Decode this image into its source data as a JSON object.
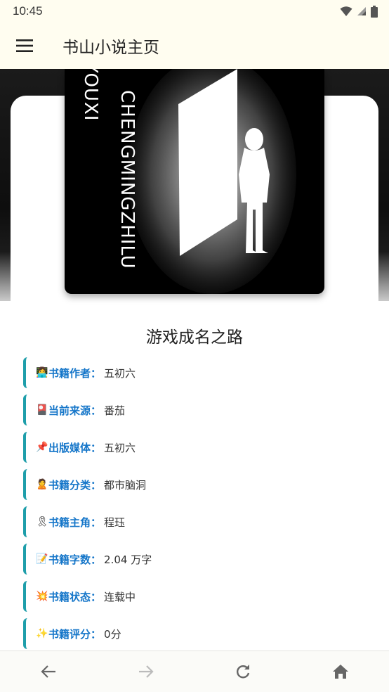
{
  "status": {
    "time": "10:45"
  },
  "app": {
    "title": "书山小说主页"
  },
  "cover": {
    "lines": [
      "YOUXI",
      "CHENGMINGZHILU"
    ]
  },
  "book": {
    "title": "游戏成名之路",
    "info": [
      {
        "emoji": "👩‍💻",
        "label": "书籍作者",
        "value": "五初六"
      },
      {
        "emoji": "🎴",
        "label": "当前来源",
        "value": "番茄"
      },
      {
        "emoji": "📌",
        "label": "出版媒体",
        "value": "五初六"
      },
      {
        "emoji": "🙎",
        "label": "书籍分类",
        "value": "都市脑洞"
      },
      {
        "emoji": "🎗",
        "label": "书籍主角",
        "value": "程珏"
      },
      {
        "emoji": "📝",
        "label": "书籍字数",
        "value": "2.04 万字"
      },
      {
        "emoji": "💥",
        "label": "书籍状态",
        "value": "连载中"
      },
      {
        "emoji": "✨",
        "label": "书籍评分",
        "value": "0分"
      }
    ],
    "colon": "："
  },
  "nav": {
    "icons": [
      "back-arrow-icon",
      "forward-arrow-icon",
      "refresh-icon",
      "home-icon"
    ]
  },
  "colors": {
    "appbar_bg": "#fffdf0",
    "accent_border": "#1e9eaa",
    "label_blue": "#1576c9"
  }
}
